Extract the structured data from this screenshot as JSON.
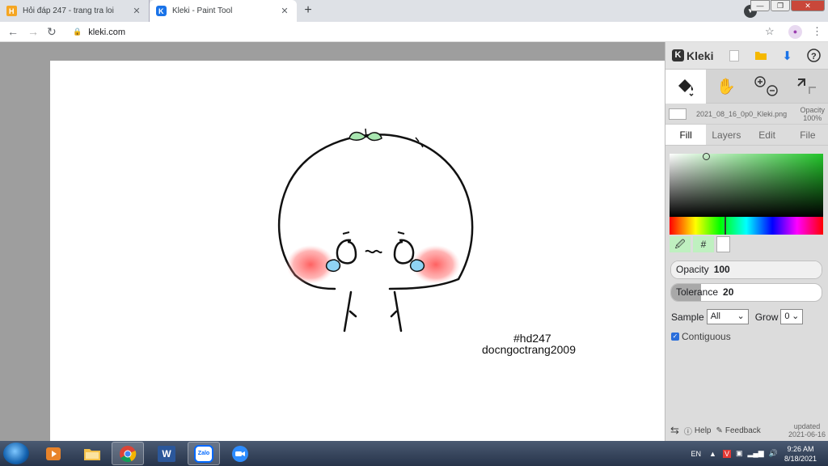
{
  "browser": {
    "tabs": [
      {
        "title": "Hỏi đáp 247 - trang tra loi",
        "favicon": "hoidap-favicon",
        "active": false
      },
      {
        "title": "Kleki - Paint Tool",
        "favicon": "kleki-favicon",
        "active": true
      }
    ],
    "new_tab_icon": "plus-icon",
    "url": "kleki.com"
  },
  "kleki": {
    "logo_text": "Kleki",
    "file_name": "2021_08_16_0p0_Kleki.png",
    "layer_opacity_label": "Opacity",
    "layer_opacity_value": "100%",
    "tabs": [
      "Fill",
      "Layers",
      "Edit",
      "File"
    ],
    "active_tab": "Fill",
    "hex_button": "#",
    "opacity": {
      "label": "Opacity",
      "value": "100",
      "fraction": 1.0
    },
    "tolerance": {
      "label": "Tolerance",
      "value": "20",
      "fraction": 0.2
    },
    "sample_label": "Sample",
    "sample_value": "All",
    "grow_label": "Grow",
    "grow_value": "0",
    "contiguous_label": "Contiguous",
    "contiguous_checked": true,
    "footer": {
      "help": "Help",
      "feedback": "Feedback",
      "updated_label": "updated",
      "updated_date": "2021-06-16"
    },
    "colors": {
      "primary_fill": "#22c42a",
      "blush": "#ff5a5a",
      "tears": "#8fd3f4"
    }
  },
  "canvas": {
    "watermark_line1": "#hd247",
    "watermark_line2": "docngoctrang2009"
  },
  "taskbar": {
    "apps": [
      "start-orb",
      "media-player-icon",
      "file-explorer-icon",
      "chrome-icon",
      "word-icon",
      "zalo-icon",
      "zoom-icon"
    ],
    "zalo_label": "Zalo",
    "word_label": "W",
    "language": "EN",
    "time": "9:26 AM",
    "date": "8/18/2021"
  }
}
